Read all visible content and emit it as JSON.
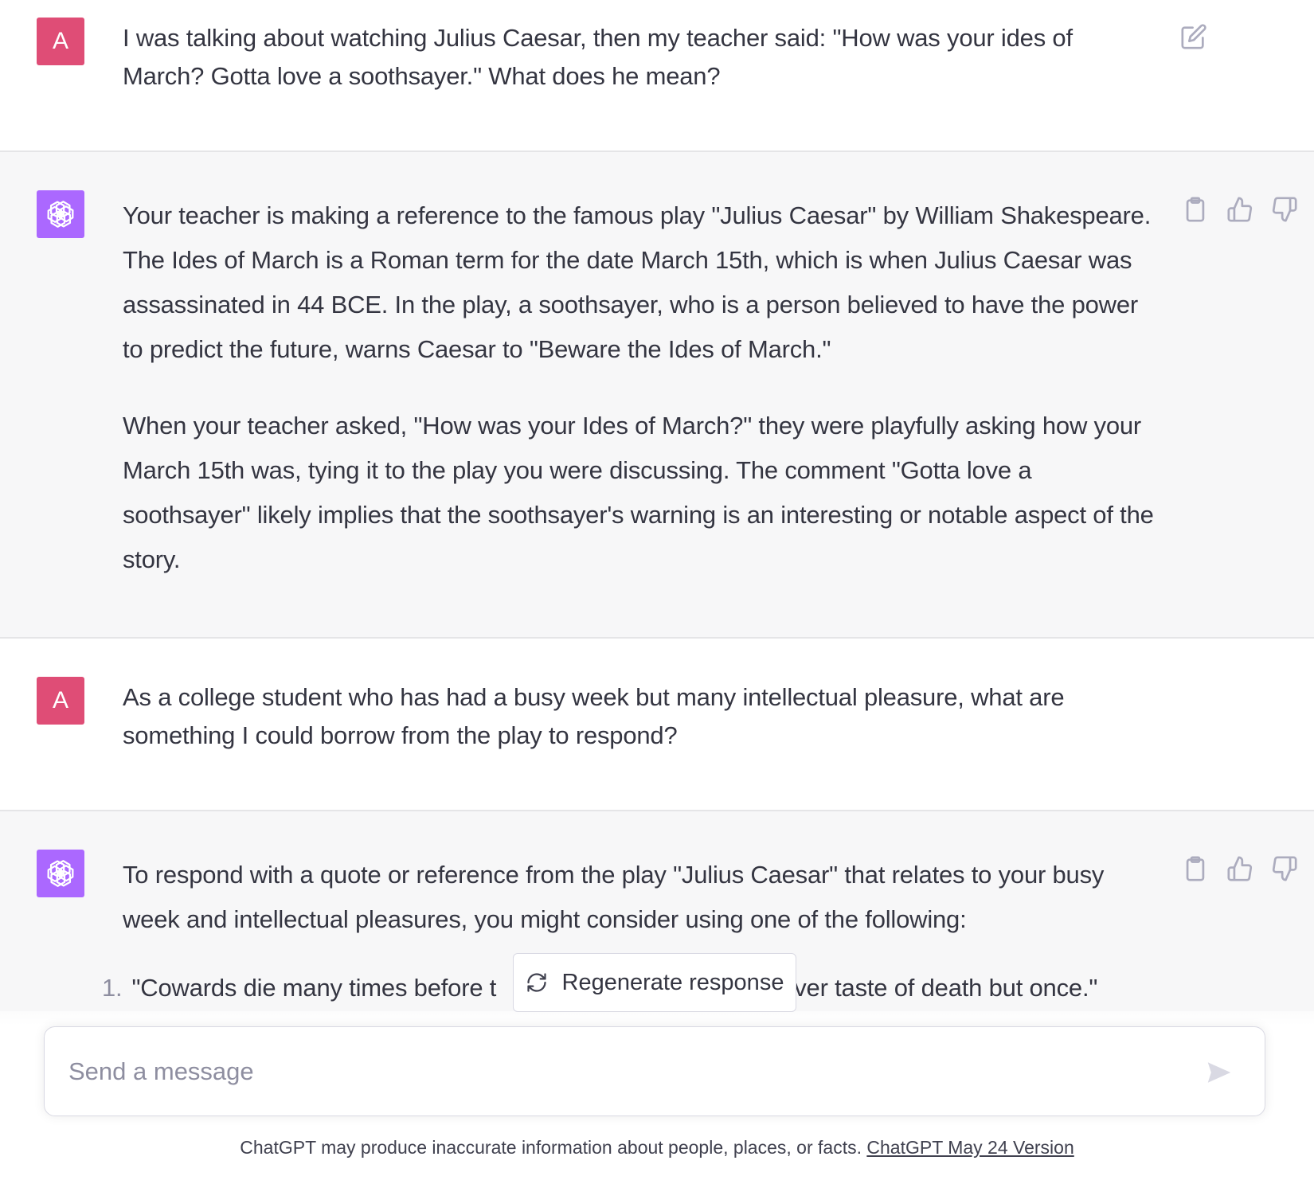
{
  "conversation": {
    "turns": [
      {
        "role": "user",
        "avatar_letter": "A",
        "text": "I was talking about watching Julius Caesar, then my teacher said: \"How was your ides of March? Gotta love a soothsayer.\" What does he mean?"
      },
      {
        "role": "assistant",
        "paragraphs": [
          "Your teacher is making a reference to the famous play \"Julius Caesar\" by William Shakespeare. The Ides of March is a Roman term for the date March 15th, which is when Julius Caesar was assassinated in 44 BCE. In the play, a soothsayer, who is a person believed to have the power to predict the future, warns Caesar to \"Beware the Ides of March.\"",
          "When your teacher asked, \"How was your Ides of March?\" they were playfully asking how your March 15th was, tying it to the play you were discussing. The comment \"Gotta love a soothsayer\" likely implies that the soothsayer's warning is an interesting or notable aspect of the story."
        ]
      },
      {
        "role": "user",
        "avatar_letter": "A",
        "text": "As a college student who has had a busy week but many intellectual pleasure, what are something I could borrow from the play to respond?"
      },
      {
        "role": "assistant",
        "paragraphs": [
          "To respond with a quote or reference from the play \"Julius Caesar\" that relates to your busy week and intellectual pleasures, you might consider using one of the following:"
        ],
        "list_items": [
          {
            "number": "1.",
            "text_visible_start": "\"Cowards die many times before t",
            "text_visible_end": "ever taste of death but once.\""
          }
        ]
      }
    ]
  },
  "regenerate": {
    "label": "Regenerate response"
  },
  "composer": {
    "placeholder": "Send a message",
    "value": ""
  },
  "footer": {
    "text": "ChatGPT may produce inaccurate information about people, places, or facts.",
    "link_text": "ChatGPT May 24 Version"
  },
  "colors": {
    "user_avatar_bg": "#df4d76",
    "bot_avatar_bg": "#ab68ff",
    "assistant_turn_bg": "#f7f7f8",
    "icon_gray": "#acacbe"
  },
  "icons": {
    "user_actions": [
      "edit-icon"
    ],
    "assistant_actions": [
      "copy-icon",
      "thumbs-up-icon",
      "thumbs-down-icon"
    ],
    "regenerate": "refresh-icon",
    "send": "send-icon",
    "bot_avatar": "openai-logo-icon"
  }
}
